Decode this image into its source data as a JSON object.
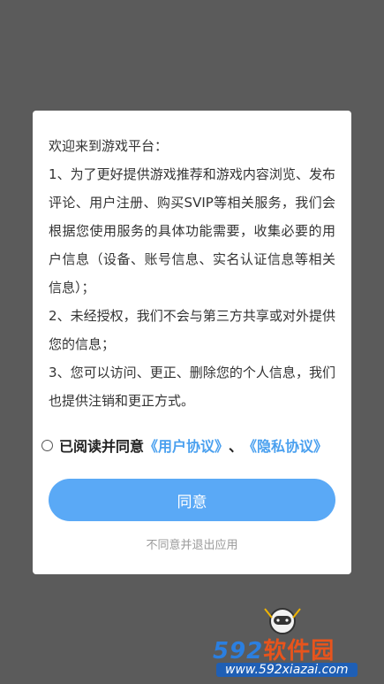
{
  "dialog": {
    "intro": "欢迎来到游戏平台：",
    "paragraphs": [
      "1、为了更好提供游戏推荐和游戏内容浏览、发布评论、用户注册、购买SVIP等相关服务，我们会根据您使用服务的具体功能需要，收集必要的用户信息（设备、账号信息、实名认证信息等相关信息）；",
      "2、未经授权，我们不会与第三方共享或对外提供您的信息；",
      "3、您可以访问、更正、删除您的个人信息，我们也提供注销和更正方式。"
    ],
    "agree_prefix": "已阅读并同意",
    "user_agreement_link": "《用户协议》",
    "separator": "、",
    "privacy_link": "《隐私协议》",
    "agree_button": "同意",
    "decline_link": "不同意并退出应用"
  },
  "watermark": {
    "number": "592",
    "name": "软件园",
    "url": "www.592xiazai.com"
  },
  "colors": {
    "overlay": "#5b5b5b",
    "accent": "#5aa9f6",
    "link": "#4aa0ef"
  }
}
